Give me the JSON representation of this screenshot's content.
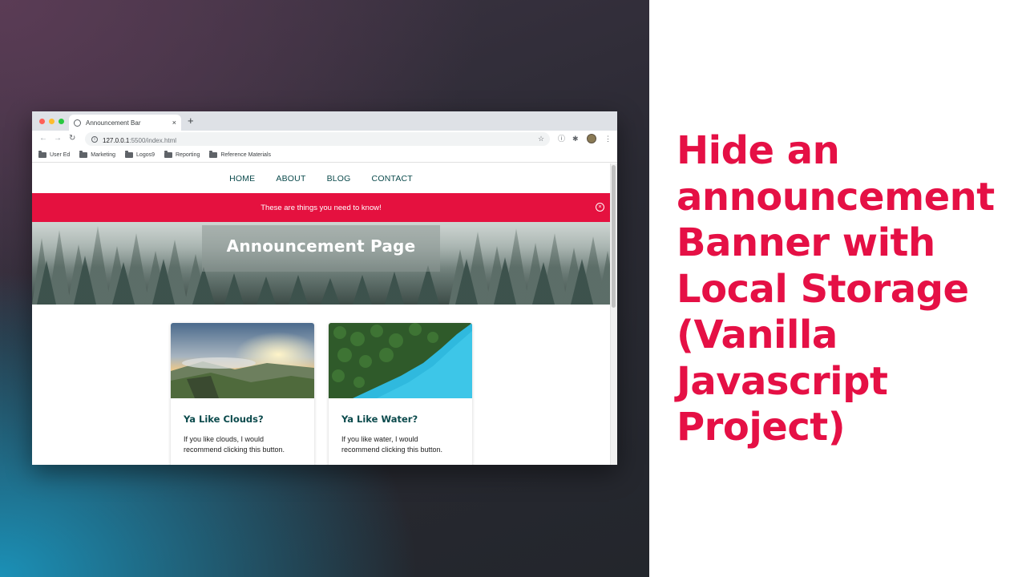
{
  "headline": "Hide an announcement Banner with Local Storage (Vanilla Javascript Project)",
  "browser": {
    "tab_title": "Announcement Bar",
    "tab_close": "×",
    "new_tab": "+",
    "url_host": "127.0.0.1",
    "url_path": ":5500/index.html",
    "bookmarks": [
      "User Ed",
      "Marketing",
      "Logos9",
      "Reporting",
      "Reference Materials"
    ]
  },
  "site": {
    "nav": [
      "HOME",
      "ABOUT",
      "BLOG",
      "CONTACT"
    ],
    "announcement": "These are things you need to know!",
    "close_glyph": "×",
    "hero_title": "Announcement Page",
    "cards": [
      {
        "title": "Ya Like Clouds?",
        "text": "If you like clouds, I would recommend clicking this button."
      },
      {
        "title": "Ya Like Water?",
        "text": "If you like water, I would recommend clicking this button."
      }
    ]
  },
  "colors": {
    "accent": "#e5113f",
    "headline": "#e51045",
    "nav_text": "#0b4a4c"
  }
}
